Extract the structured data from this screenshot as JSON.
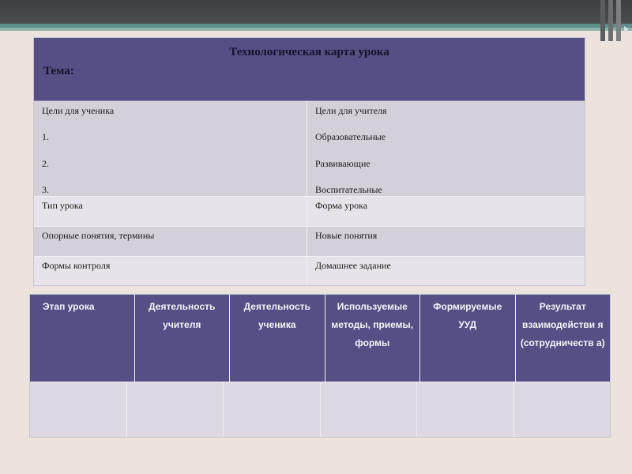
{
  "card": {
    "title": "Технологическая карта урока",
    "topic": "Тема:",
    "student_goals": {
      "label": "Цели для ученика",
      "items": [
        "1.",
        "2.",
        "3."
      ]
    },
    "teacher_goals": {
      "label": "Цели для учителя",
      "items": [
        "Образовательные",
        "Развивающие",
        "Воспитательные"
      ]
    },
    "rows": [
      {
        "left": "Тип урока",
        "right": "Форма урока"
      },
      {
        "left": "Опорные понятия, термины",
        "right": "Новые понятия"
      },
      {
        "left": "Формы контроля",
        "right": "Домашнее задание"
      }
    ]
  },
  "stages_table": {
    "headers": [
      "Этап урока",
      "Деятельность учителя",
      "Деятельность ученика",
      "Используемые методы, приемы, формы",
      "Формируемые УУД",
      "Результат взаимодействи я (сотрудничеств а)"
    ]
  },
  "colors": {
    "header_purple": "#554f85",
    "cell_light": "#e6e4ea",
    "cell_mid": "#d3d0da",
    "accent_teal": "#5f8e8a",
    "background": "#ece4dc"
  }
}
